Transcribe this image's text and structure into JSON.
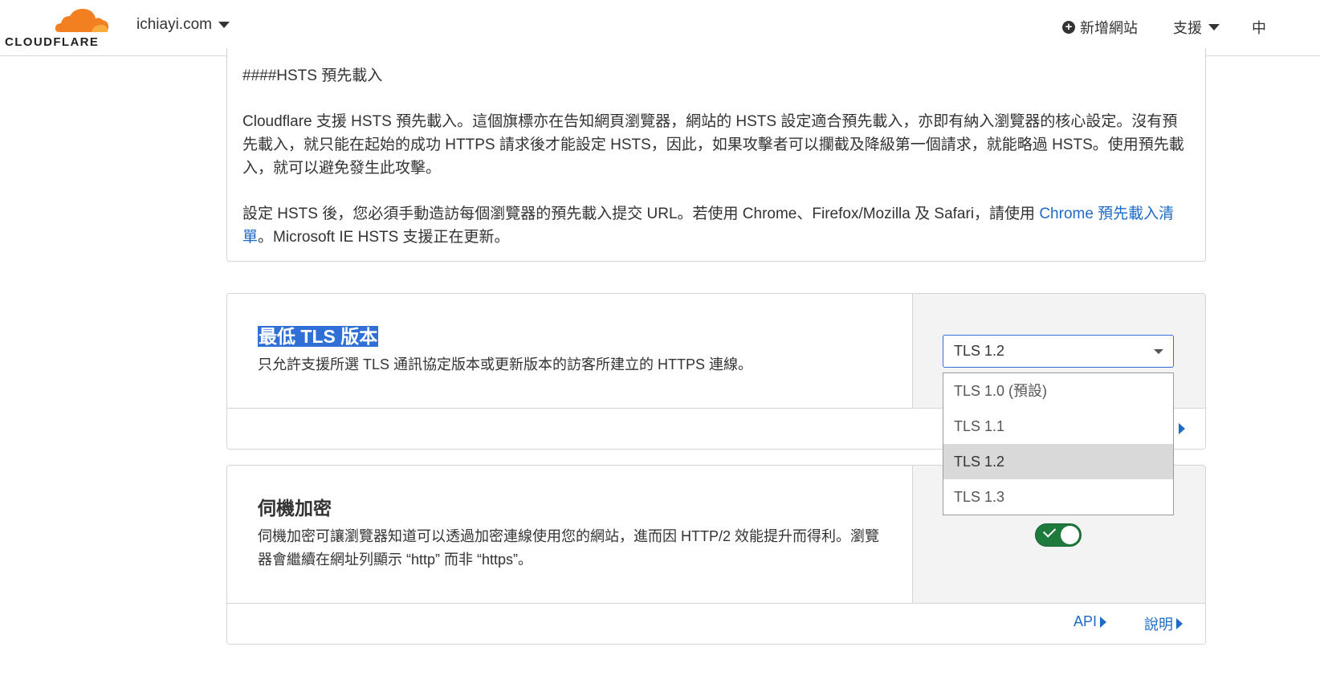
{
  "header": {
    "logo_text": "CLOUDFLARE",
    "site": "ichiayi.com",
    "add_site": "新增網站",
    "support": "支援",
    "language": "中"
  },
  "hsts": {
    "heading": "####HSTS 預先載入",
    "para1": "Cloudflare 支援 HSTS 預先載入。這個旗標亦在告知網頁瀏覽器，網站的 HSTS 設定適合預先載入，亦即有納入瀏覽器的核心設定。沒有預先載入，就只能在起始的成功 HTTPS 請求後才能設定 HSTS，因此，如果攻擊者可以攔截及降級第一個請求，就能略過 HSTS。使用預先載入，就可以避免發生此攻擊。",
    "para2_before": "設定 HSTS 後，您必須手動造訪每個瀏覽器的預先載入提交 URL。若使用 Chrome、Firefox/Mozilla 及 Safari，請使用 ",
    "para2_link": "Chrome 預先載入清單",
    "para2_after": "。Microsoft IE HSTS 支援正在更新。"
  },
  "min_tls": {
    "title": "最低 TLS 版本",
    "description": "只允許支援所選 TLS 通訊協定版本或更新版本的訪客所建立的 HTTPS 連線。",
    "selected": "TLS 1.2",
    "options": [
      "TLS 1.0 (預設)",
      "TLS 1.1",
      "TLS 1.2",
      "TLS 1.3"
    ]
  },
  "opportunistic": {
    "title": "伺機加密",
    "description": "伺機加密可讓瀏覽器知道可以透過加密連線使用您的網站，進而因 HTTP/2 效能提升而得利。瀏覽器會繼續在網址列顯示 “http” 而非 “https”。",
    "enabled": true,
    "api_link": "API",
    "help_link": "說明"
  },
  "colors": {
    "accent": "#1e6ac7",
    "toggle_on": "#1f7a3d",
    "selected_bg": "#d9d9d9",
    "logo_orange": "#f38020"
  }
}
